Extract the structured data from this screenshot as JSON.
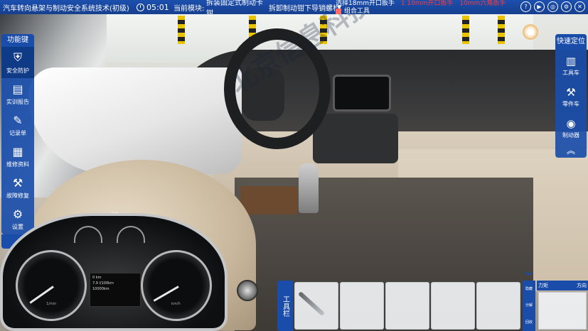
{
  "header": {
    "app_title": "汽车转向悬架与制动安全系统技术(初级)",
    "timer": "05:01",
    "module_label": "当前模块:",
    "module_name": "拆装固定式制动卡钳",
    "current_step": "拆卸制动钳下导销螺栓"
  },
  "task": {
    "instruction": "选择18mm开口扳手",
    "highlight": "18mm开口扳手",
    "extra": "1 10mm开口扳手",
    "extra2": "10mm六角扳手",
    "tools_label": "组合工具"
  },
  "top_icons": [
    "help-icon",
    "play-icon",
    "target-icon",
    "settings-icon",
    "close-icon"
  ],
  "left_panel": {
    "title": "功能键",
    "items": [
      {
        "label": "安全防护",
        "icon": "shield-icon"
      },
      {
        "label": "实训报告",
        "icon": "report-icon"
      },
      {
        "label": "记录单",
        "icon": "record-icon"
      },
      {
        "label": "维修资料",
        "icon": "manual-icon"
      },
      {
        "label": "故障修复",
        "icon": "wrench-icon"
      },
      {
        "label": "设置",
        "icon": "gear-icon"
      }
    ]
  },
  "right_panel": {
    "title": "快速定位",
    "items": [
      {
        "label": "工具车",
        "icon": "toolcart-icon"
      },
      {
        "label": "零件车",
        "icon": "partscart-icon"
      },
      {
        "label": "制动器",
        "icon": "brake-icon"
      }
    ]
  },
  "cluster": {
    "left_unit": "1/min",
    "right_unit": "km/h",
    "odo_label": "0 km",
    "consumption": "7.9 l/100km",
    "trip": "10000km"
  },
  "toolbar": {
    "label": "工具栏",
    "side_buttons": [
      "隐藏",
      "分解",
      "回收"
    ],
    "torque_label": "力矩",
    "direction_label": "方向"
  },
  "watermark": "北京信息科技(江苏)有限公司",
  "colors": {
    "primary": "#1a4caa",
    "alert": "#ff3b3b"
  }
}
